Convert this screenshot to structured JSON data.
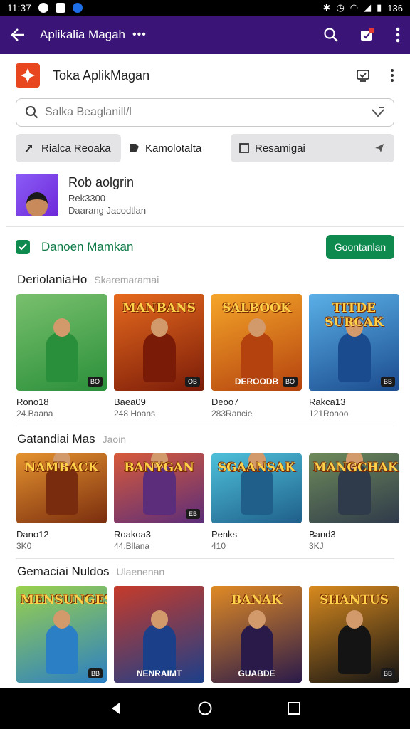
{
  "status": {
    "time": "11:37",
    "battery": "136"
  },
  "appbar": {
    "title": "Aplikalia Magah",
    "more": "•••"
  },
  "app": {
    "name": "Toka AplikMagan"
  },
  "search": {
    "placeholder": "Salka Beaglanill/l"
  },
  "chips": {
    "c1": "Rialca Reoaka",
    "c2": "Kamolotalta",
    "c3": "Resamigai"
  },
  "profile": {
    "name": "Rob aolgrin",
    "sub1": "Rek3300",
    "sub2": "Daarang Jacodtlan"
  },
  "recommend": {
    "label": "Danoen Mamkan",
    "button": "Goontanlan"
  },
  "sections": [
    {
      "title": "DeriolaniaHo",
      "subtitle": "Skaremaramai",
      "items": [
        {
          "banner": "",
          "caption": "",
          "badge": "BO",
          "name": "Rono18",
          "meta": "24.Baana",
          "colors": [
            "#2a8f3a",
            "#79c06d"
          ]
        },
        {
          "banner": "MANBANS",
          "caption": "",
          "badge": "OB",
          "name": "Baea09",
          "meta": "248 Hoans",
          "colors": [
            "#7a1b08",
            "#e66a1e"
          ]
        },
        {
          "banner": "SALBOOK",
          "caption": "DEROODB",
          "badge": "BO",
          "name": "Deoo7",
          "meta": "283Rancie",
          "colors": [
            "#b4420f",
            "#f5a629"
          ]
        },
        {
          "banner": "TITDE SURCAK",
          "caption": "",
          "badge": "BB",
          "name": "Rakca13",
          "meta": "121Roaoo",
          "colors": [
            "#1b4b8f",
            "#5ab0e6"
          ]
        }
      ]
    },
    {
      "title": "Gatandiai Mas",
      "subtitle": "Jaoin",
      "items": [
        {
          "banner": "NAMBACK",
          "caption": "",
          "badge": "",
          "name": "Dano12",
          "meta": "3K0",
          "colors": [
            "#7a2d0e",
            "#e4922e"
          ]
        },
        {
          "banner": "BANYGAN",
          "caption": "",
          "badge": "EB",
          "name": "Roakoa3",
          "meta": "44.Bllana",
          "colors": [
            "#5b2d7a",
            "#d75a3a"
          ]
        },
        {
          "banner": "SGAANSAK",
          "caption": "",
          "badge": "",
          "name": "Penks",
          "meta": "410",
          "colors": [
            "#1f5f8a",
            "#4ec0d9"
          ]
        },
        {
          "banner": "MANGCHAK",
          "caption": "",
          "badge": "",
          "name": "Band3",
          "meta": "3KJ",
          "colors": [
            "#2f3a4a",
            "#6e8a5a"
          ]
        }
      ]
    },
    {
      "title": "Gemaciai Nuldos",
      "subtitle": "Ulaenenan",
      "items": [
        {
          "banner": "MENSUNGES",
          "caption": "",
          "badge": "BB",
          "name": "",
          "meta": "",
          "colors": [
            "#2b7fc4",
            "#9ad14b"
          ]
        },
        {
          "banner": "",
          "caption": "NENRAIMT",
          "badge": "",
          "name": "",
          "meta": "",
          "colors": [
            "#1c3f8a",
            "#c63b2a"
          ]
        },
        {
          "banner": "BANAK",
          "caption": "GUABDE",
          "badge": "",
          "name": "",
          "meta": "",
          "colors": [
            "#2a1a4a",
            "#e08a24"
          ]
        },
        {
          "banner": "SHANTUS",
          "caption": "",
          "badge": "BB",
          "name": "",
          "meta": "",
          "colors": [
            "#141414",
            "#d88a1e"
          ]
        }
      ]
    }
  ]
}
